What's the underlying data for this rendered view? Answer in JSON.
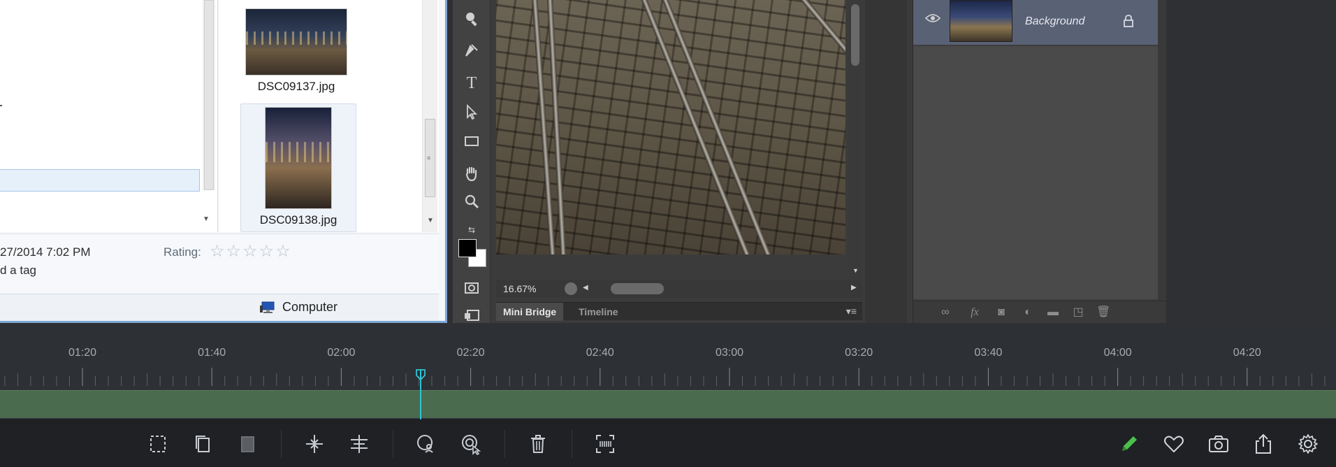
{
  "explorer": {
    "thumbnails": [
      {
        "caption": "DSC09137.jpg"
      },
      {
        "caption": "DSC09138.jpg"
      }
    ],
    "details": {
      "date_fragment": "27/2014 7:02 PM",
      "tag_fragment": "d a tag",
      "rating_label": "Rating:",
      "rating_stars": "☆☆☆☆☆",
      "rating_value": 0
    },
    "status": {
      "location": "Computer"
    }
  },
  "photoshop": {
    "tools": [
      "zoom-tool",
      "pen-tool",
      "type-tool",
      "path-selection-tool",
      "rectangle-tool",
      "hand-tool",
      "zoom-tool-2"
    ],
    "zoom": "16.67%",
    "tabs": [
      {
        "label": "Mini Bridge",
        "active": true
      },
      {
        "label": "Timeline",
        "active": false
      }
    ],
    "layers": {
      "items": [
        {
          "name": "Background",
          "visible": true,
          "locked": true,
          "selected": true
        }
      ],
      "footer_icons": [
        "link-icon",
        "fx-icon",
        "mask-icon",
        "adjustment-icon",
        "folder-icon",
        "new-layer-icon",
        "trash-icon"
      ]
    }
  },
  "timeline": {
    "ticks": [
      {
        "label": "01:20"
      },
      {
        "label": "01:40"
      },
      {
        "label": "02:00"
      },
      {
        "label": "02:20"
      },
      {
        "label": "02:40"
      },
      {
        "label": "03:00"
      },
      {
        "label": "03:20"
      },
      {
        "label": "03:40"
      },
      {
        "label": "04:00"
      },
      {
        "label": "04:20"
      }
    ],
    "playhead_time": "02:15",
    "track_color": "#4a6b4d",
    "playhead_color": "#2ec4d6"
  },
  "toolbar": {
    "buttons": [
      {
        "name": "select-region-button",
        "icon": "select-region-icon"
      },
      {
        "name": "copy-button",
        "icon": "copy-icon"
      },
      {
        "name": "paste-button",
        "icon": "paste-icon",
        "disabled": true
      },
      {
        "name": "split-button",
        "icon": "split-icon"
      },
      {
        "name": "trim-button",
        "icon": "trim-icon"
      },
      {
        "name": "zoom-to-playhead-button",
        "icon": "zoom-person-icon"
      },
      {
        "name": "zoom-to-selection-button",
        "icon": "zoom-cursor-icon"
      },
      {
        "name": "delete-button",
        "icon": "trash-icon"
      },
      {
        "name": "fit-timeline-button",
        "icon": "fit-icon"
      },
      {
        "name": "edit-button",
        "icon": "pencil-icon",
        "color": "#4cc04c"
      },
      {
        "name": "favorite-button",
        "icon": "heart-icon"
      },
      {
        "name": "snapshot-button",
        "icon": "camera-icon"
      },
      {
        "name": "share-button",
        "icon": "share-icon"
      },
      {
        "name": "settings-button",
        "icon": "gear-icon"
      }
    ]
  }
}
